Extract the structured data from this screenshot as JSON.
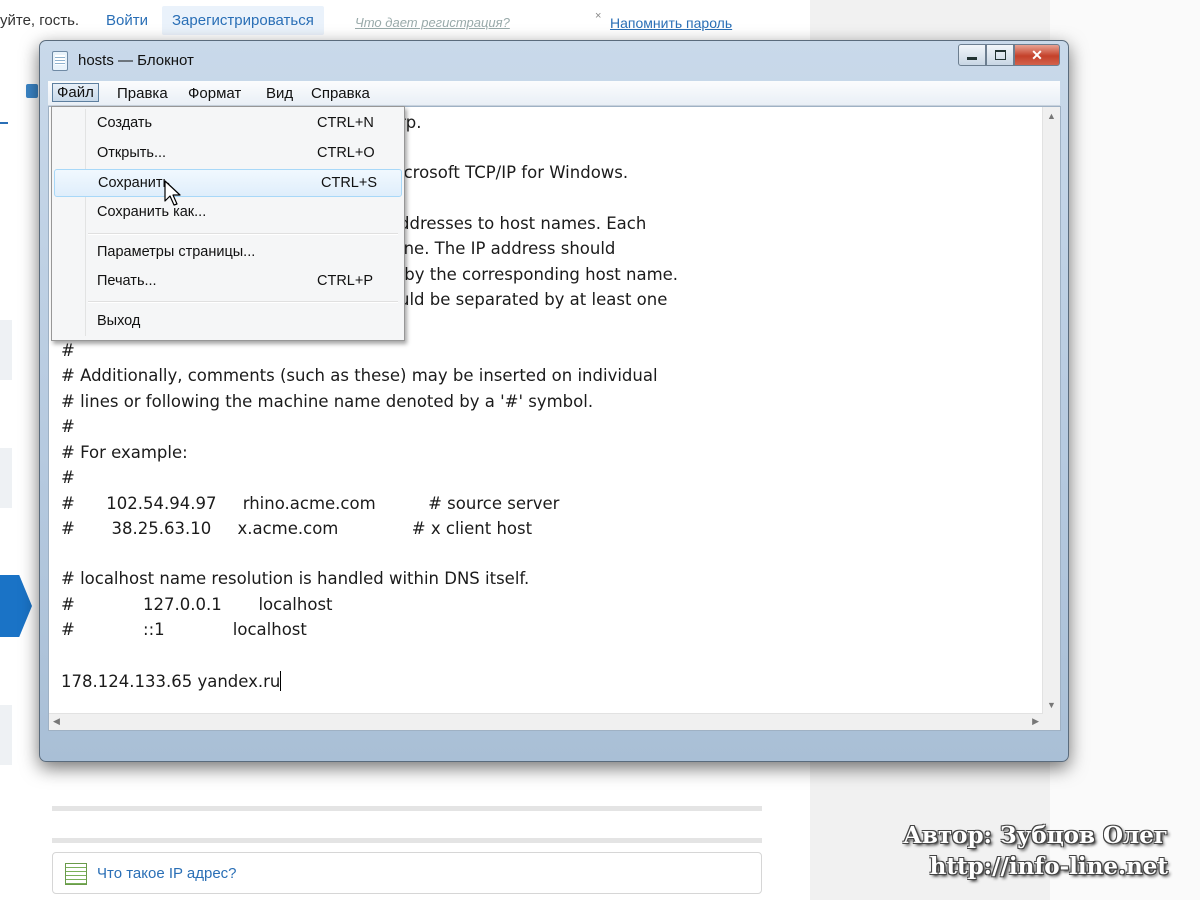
{
  "site": {
    "greeting": "уйте, гость.",
    "login_link": "Войти",
    "register_button": "Зарегистрироваться",
    "why_register_link": "Что дает регистрация?",
    "remind_password_link": "Напомнить пароль",
    "close_mark": "×",
    "ip_box_link": "Что такое IP адрес?",
    "watermark": {
      "author": "Автор: Зубцов Олег",
      "url": "http://info-line.net"
    }
  },
  "window": {
    "title": "hosts — Блокнот",
    "close_glyph": "✕"
  },
  "menu": {
    "file": "Файл",
    "edit": "Правка",
    "format": "Формат",
    "view": "Вид",
    "help": "Справка"
  },
  "file_menu": {
    "items": [
      {
        "label": "Создать",
        "shortcut": "CTRL+N"
      },
      {
        "label": "Открыть...",
        "shortcut": "CTRL+O"
      },
      {
        "label": "Сохранить",
        "shortcut": "CTRL+S"
      },
      {
        "label": "Сохранить как...",
        "shortcut": ""
      },
      {
        "label": "Параметры страницы...",
        "shortcut": ""
      },
      {
        "label": "Печать...",
        "shortcut": "CTRL+P"
      },
      {
        "label": "Выход",
        "shortcut": ""
      }
    ],
    "highlighted_index": 2
  },
  "editor": {
    "lines": [
      "rp.",
      "icrosoft TCP/IP for Windows.",
      "ddresses to host names. Each",
      "ine. The IP address should",
      " by the corresponding host name.",
      "uld be separated by at least one",
      "#",
      "# Additionally, comments (such as these) may be inserted on individual",
      "# lines or following the machine name denoted by a '#' symbol.",
      "#",
      "# For example:",
      "#",
      "#      102.54.94.97     rhino.acme.com          # source server",
      "#       38.25.63.10     x.acme.com              # x client host",
      "# localhost name resolution is handled within DNS itself.",
      "#             127.0.0.1       localhost",
      "#             ::1             localhost",
      "178.124.133.65 yandex.ru"
    ]
  }
}
